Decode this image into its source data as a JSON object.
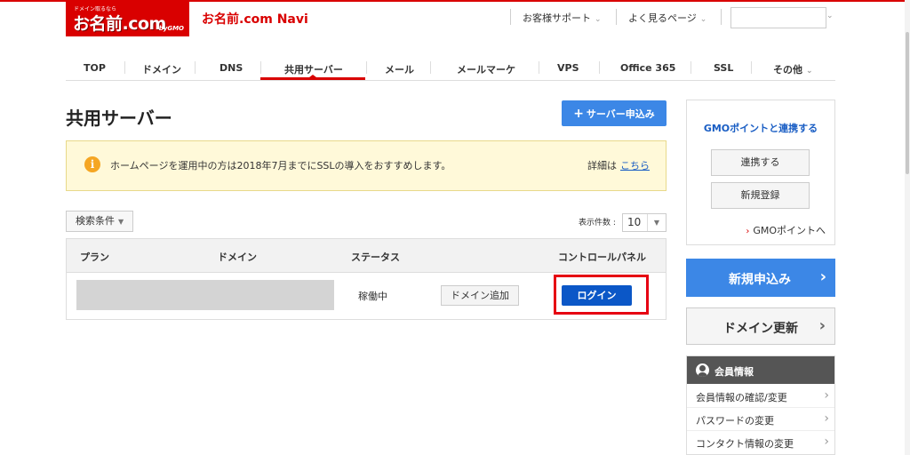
{
  "header": {
    "logo": {
      "tagline": "ドメイン取るなら",
      "mark": "お名前.com",
      "gmo": "byGMO"
    },
    "app_title": "お名前.com Navi",
    "support_label": "お客様サポート",
    "faq_label": "よく見るページ"
  },
  "nav": {
    "items": [
      {
        "label": "TOP"
      },
      {
        "label": "ドメイン"
      },
      {
        "label": "DNS"
      },
      {
        "label": "共用サーバー",
        "active": true
      },
      {
        "label": "メール"
      },
      {
        "label": "メールマーケ"
      },
      {
        "label": "VPS"
      },
      {
        "label": "Office 365"
      },
      {
        "label": "SSL"
      },
      {
        "label": "その他"
      }
    ]
  },
  "main": {
    "title": "共用サーバー",
    "apply_button": "サーバー申込み",
    "notice": {
      "text": "ホームページを運用中の方は2018年7月までにSSLの導入をおすすめします。",
      "detail_prefix": "詳細は",
      "detail_link": "こちら"
    },
    "filter_label": "検索条件",
    "per_page_label": "表示件数 :",
    "per_page_value": "10",
    "table": {
      "columns": [
        "プラン",
        "ドメイン",
        "ステータス",
        "コントロールパネル"
      ],
      "rows": [
        {
          "status": "稼働中",
          "add_domain": "ドメイン追加",
          "login": "ログイン"
        }
      ]
    }
  },
  "sidebar": {
    "gmo_title": "GMOポイントと連携する",
    "link_button": "連携する",
    "register_button": "新規登録",
    "gmo_link": "GMOポイントへ",
    "new_apply": "新規申込み",
    "renew_domain": "ドメイン更新",
    "member": {
      "title": "会員情報",
      "items": [
        "会員情報の確認/変更",
        "パスワードの変更",
        "コンタクト情報の変更"
      ]
    }
  },
  "colors": {
    "brand_red": "#d90000",
    "accent_blue": "#3c87e6",
    "login_blue": "#0b57c7",
    "highlight": "#e60012"
  }
}
